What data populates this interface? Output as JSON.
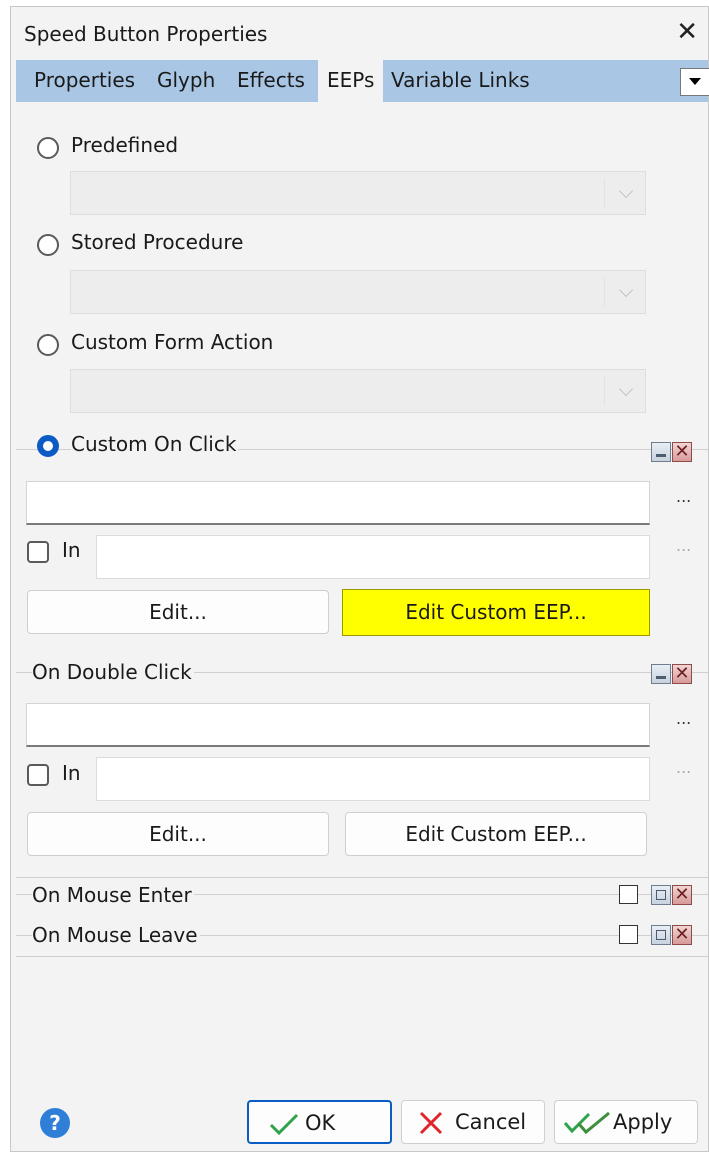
{
  "window": {
    "title": "Speed Button Properties",
    "close_glyph": "✕"
  },
  "tabs": [
    {
      "label": "Properties"
    },
    {
      "label": "Glyph"
    },
    {
      "label": "Effects"
    },
    {
      "label": "EEPs",
      "active": true
    },
    {
      "label": "Variable Links"
    }
  ],
  "actions": {
    "predefined": {
      "label": "Predefined",
      "selected": false,
      "value": ""
    },
    "stored_procedure": {
      "label": "Stored Procedure",
      "selected": false,
      "value": ""
    },
    "custom_form_action": {
      "label": "Custom Form Action",
      "selected": false,
      "value": ""
    },
    "custom_on_click": {
      "label": "Custom On Click",
      "selected": true
    }
  },
  "on_click": {
    "field_value": "",
    "in_label": "In",
    "in_checked": false,
    "in_value": "",
    "ellipsis": "...",
    "edit_label": "Edit...",
    "edit_custom_label": "Edit Custom EEP..."
  },
  "on_double_click": {
    "label": "On Double Click",
    "field_value": "",
    "in_label": "In",
    "in_checked": false,
    "in_value": "",
    "ellipsis": "...",
    "edit_label": "Edit...",
    "edit_custom_label": "Edit Custom EEP..."
  },
  "on_mouse_enter": {
    "label": "On Mouse Enter",
    "checked": false
  },
  "on_mouse_leave": {
    "label": "On Mouse Leave",
    "checked": false
  },
  "footer": {
    "help_glyph": "?",
    "ok_label": "OK",
    "cancel_label": "Cancel",
    "apply_label": "Apply"
  },
  "colors": {
    "tab_strip": "#a9c7e4",
    "highlight_button": "#ffff00",
    "accent": "#0a5bc4"
  }
}
